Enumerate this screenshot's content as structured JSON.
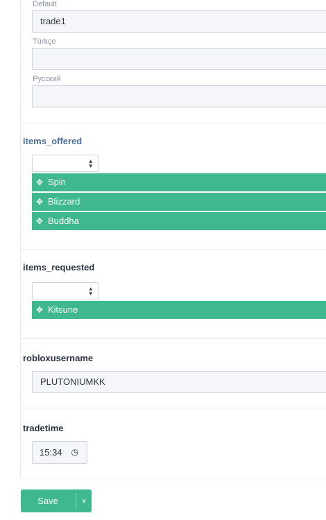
{
  "name_translations": [
    {
      "label": "Default",
      "value": "trade1"
    },
    {
      "label": "Türkçe",
      "value": ""
    },
    {
      "label": "Русский",
      "value": ""
    }
  ],
  "items_offered": {
    "title": "items_offered",
    "select_value": "",
    "items": [
      "Spin",
      "Blizzard",
      "Buddha"
    ]
  },
  "items_requested": {
    "title": "items_requested",
    "select_value": "",
    "items": [
      "Kitsune"
    ]
  },
  "robloxusername": {
    "title": "robloxusername",
    "value": "PLUTONIUMKK"
  },
  "tradetime": {
    "title": "tradetime",
    "value": "15:34"
  },
  "actions": {
    "save_label": "Save"
  },
  "icons": {
    "move": "move-icon",
    "clock": "clock-icon",
    "caret": "chevron-down-icon",
    "select_arrows": "sort-arrows-icon"
  },
  "colors": {
    "tag_bg": "#3fb890",
    "accent_title": "#4a6f98"
  }
}
